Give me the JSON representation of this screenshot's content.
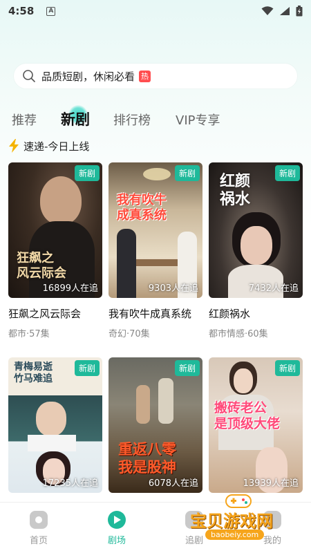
{
  "status": {
    "time": "4:58"
  },
  "search": {
    "text": "品质短剧，休闲必看",
    "badge": "热"
  },
  "tabs": [
    {
      "label": "推荐"
    },
    {
      "label": "新剧"
    },
    {
      "label": "排行榜"
    },
    {
      "label": "VIP专享"
    }
  ],
  "section": {
    "title": "速递-今日上线"
  },
  "dramas": [
    {
      "title": "狂飙之风云际会",
      "meta": "都市·57集",
      "badge": "新剧",
      "viewers": "16899人在追",
      "art": "狂飙之\n风云际会"
    },
    {
      "title": "我有吹牛成真系统",
      "meta": "奇幻·70集",
      "badge": "新剧",
      "viewers": "9303人在追",
      "art": "我有吹牛\n成真系统"
    },
    {
      "title": "红颜祸水",
      "meta": "都市情感·60集",
      "badge": "新剧",
      "viewers": "7432人在追",
      "art": "红颜\n祸水"
    },
    {
      "title": "",
      "meta": "",
      "badge": "新剧",
      "viewers": "17235人在追",
      "art": "青梅易逝\n竹马难追"
    },
    {
      "title": "",
      "meta": "",
      "badge": "新剧",
      "viewers": "6078人在追",
      "art": "重返八零\n我是股神"
    },
    {
      "title": "",
      "meta": "",
      "badge": "新剧",
      "viewers": "13939人在追",
      "art": "搬砖老公\n是顶级大佬"
    }
  ],
  "nav": [
    {
      "label": "首页"
    },
    {
      "label": "剧场"
    },
    {
      "label": "追剧"
    },
    {
      "label": "我的"
    }
  ],
  "watermark": {
    "text": "宝贝游戏网",
    "url": "baobeiy.com"
  },
  "colors": {
    "accent": "#1fb99a",
    "hot": "#ff4d4f",
    "watermark": "#f6a51c"
  }
}
